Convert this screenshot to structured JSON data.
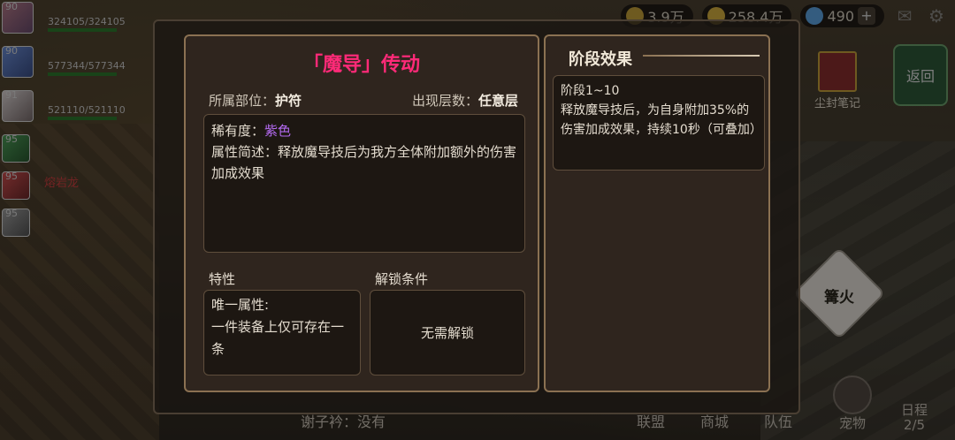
{
  "resources": [
    {
      "id": "wheat",
      "value": "3.9万",
      "color": "#c9a43b"
    },
    {
      "id": "coin",
      "value": "258.4万",
      "color": "#d9b340"
    },
    {
      "id": "gem",
      "value": "490",
      "color": "#5fa8e8"
    }
  ],
  "party": [
    {
      "level": "90",
      "name": "",
      "hp": "324105/324105"
    },
    {
      "level": "90",
      "name": "",
      "hp": "577344/577344"
    },
    {
      "level": "91",
      "name": "",
      "hp": "521110/521110"
    },
    {
      "level": "95",
      "name": ""
    },
    {
      "level": "95",
      "name": "熔岩龙"
    },
    {
      "level": "95",
      "name": ""
    }
  ],
  "side": {
    "back_label": "返回",
    "notebook_label": "尘封笔记",
    "campfire_label": "篝火"
  },
  "bottom_nav": {
    "items": [
      "联盟",
      "商城",
      "队伍"
    ],
    "pet_label": "宠物",
    "schedule_label": "日程",
    "schedule_count": "2/5"
  },
  "chat": {
    "text": "谢子衿：没有"
  },
  "rune": {
    "title": "「魔导」传动",
    "slot_label": "所属部位：",
    "slot_value": "护符",
    "layer_label": "出现层数：",
    "layer_value": "任意层",
    "rarity_label": "稀有度：",
    "rarity_value": "紫色",
    "rarity_color": "#b36af0",
    "desc": "属性简述：释放魔导技后为我方全体附加额外的伤害加成效果",
    "trait_header": "特性",
    "trait_text": "唯一属性:\n一件装备上仅可存在一条",
    "unlock_header": "解锁条件",
    "unlock_text": "无需解锁"
  },
  "stage": {
    "title": "阶段效果",
    "range": "阶段1~10",
    "text": "释放魔导技后，为自身附加35%的伤害加成效果，持续10秒（可叠加）"
  }
}
